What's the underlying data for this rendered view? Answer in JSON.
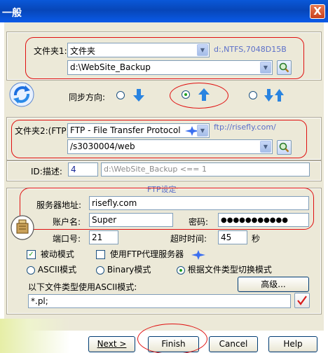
{
  "window": {
    "title": "一般",
    "close_label": "X"
  },
  "folder1": {
    "label": "文件夹1:",
    "type_value": "文件夹",
    "info": "d:,NTFS,7048D15B",
    "path": "d:\\WebSite_Backup"
  },
  "sync": {
    "label": "同步方向:",
    "selected": "right-to-left"
  },
  "folder2": {
    "label": "文件夹2:(FTP)",
    "type_value": "FTP - File Transfer Protocol",
    "info": "ftp://risefly.com/",
    "path": "/s3030004/web"
  },
  "id_row": {
    "label": "ID:描述:",
    "id_value": "4",
    "description": "d:\\WebSite_Backup <== 1"
  },
  "ftp": {
    "section_title": "FTP设定",
    "server_label": "服务器地址:",
    "server_value": "risefly.com",
    "account_label": "账户名:",
    "account_value": "Super",
    "password_label": "密码:",
    "password_value": "●●●●●●●●●●●",
    "port_label": "端口号:",
    "port_value": "21",
    "timeout_label": "超时时间:",
    "timeout_value": "45",
    "timeout_unit": "秒",
    "passive_label": "被动模式",
    "passive_checked": true,
    "proxy_label": "使用FTP代理服务器",
    "proxy_checked": false,
    "mode_ascii": "ASCII模式",
    "mode_binary": "Binary模式",
    "mode_auto": "根据文件类型切换模式",
    "mode_selected": "auto",
    "ascii_types_label": "以下文件类型使用ASCII模式:",
    "advanced_label": "高级...",
    "ascii_types_value": "*.pl;"
  },
  "footer": {
    "next_label": "Next >",
    "finish_label": "Finish",
    "cancel_label": "Cancel",
    "help_label": "Help"
  },
  "colors": {
    "accent_red": "#e01010",
    "title_blue": "#0a58d8",
    "panel": "#ece9d8"
  }
}
